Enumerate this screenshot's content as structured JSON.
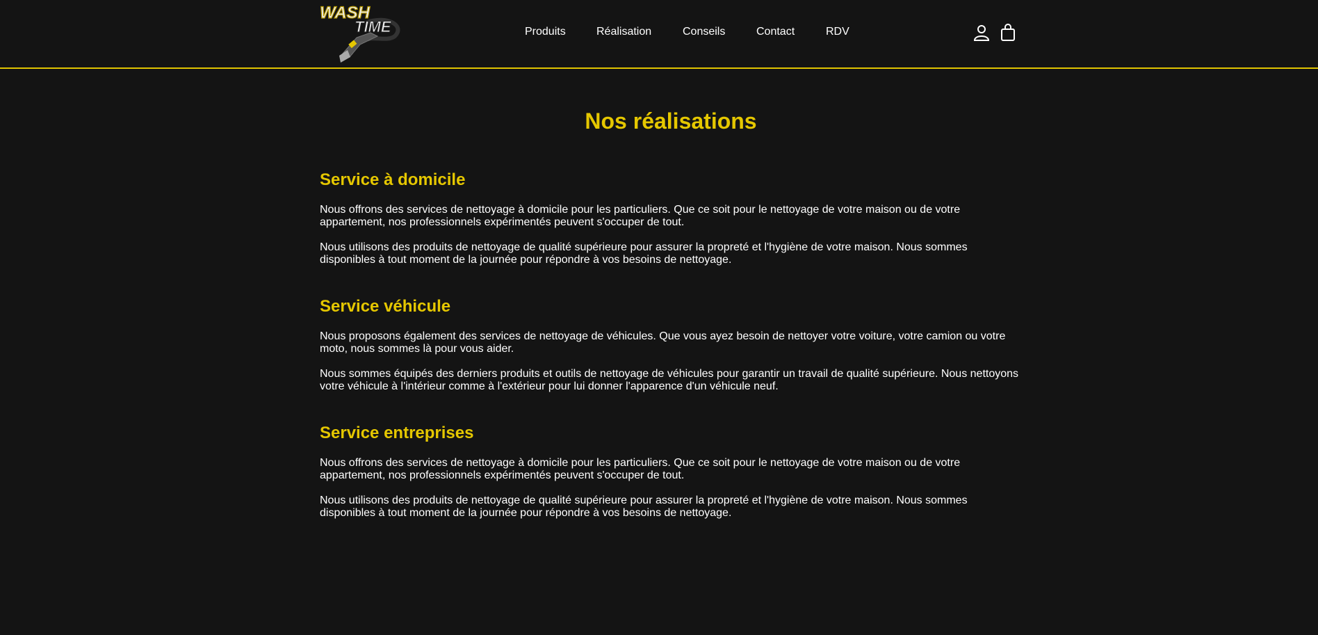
{
  "header": {
    "logo_text": "WASH TIME",
    "nav": [
      "Produits",
      "Réalisation",
      "Conseils",
      "Contact",
      "RDV"
    ],
    "icons": [
      "user-icon",
      "shopping-bag-icon"
    ]
  },
  "main": {
    "title": "Nos réalisations",
    "sections": [
      {
        "title": "Service à domicile",
        "paragraphs": [
          "Nous offrons des services de nettoyage à domicile pour les particuliers. Que ce soit pour le nettoyage de votre maison ou de votre appartement, nos professionnels expérimentés peuvent s'occuper de tout.",
          "Nous utilisons des produits de nettoyage de qualité supérieure pour assurer la propreté et l'hygiène de votre maison. Nous sommes disponibles à tout moment de la journée pour répondre à vos besoins de nettoyage."
        ]
      },
      {
        "title": "Service véhicule",
        "paragraphs": [
          "Nous proposons également des services de nettoyage de véhicules. Que vous ayez besoin de nettoyer votre voiture, votre camion ou votre moto, nous sommes là pour vous aider.",
          "Nous sommes équipés des derniers produits et outils de nettoyage de véhicules pour garantir un travail de qualité supérieure. Nous nettoyons votre véhicule à l'intérieur comme à l'extérieur pour lui donner l'apparence d'un véhicule neuf."
        ]
      },
      {
        "title": "Service entreprises",
        "paragraphs": [
          "Nous offrons des services de nettoyage à domicile pour les particuliers. Que ce soit pour le nettoyage de votre maison ou de votre appartement, nos professionnels expérimentés peuvent s'occuper de tout.",
          "Nous utilisons des produits de nettoyage de qualité supérieure pour assurer la propreté et l'hygiène de votre maison. Nous sommes disponibles à tout moment de la journée pour répondre à vos besoins de nettoyage."
        ]
      }
    ]
  },
  "colors": {
    "background": "#141414",
    "accent": "#e5c700",
    "text": "#ffffff"
  }
}
